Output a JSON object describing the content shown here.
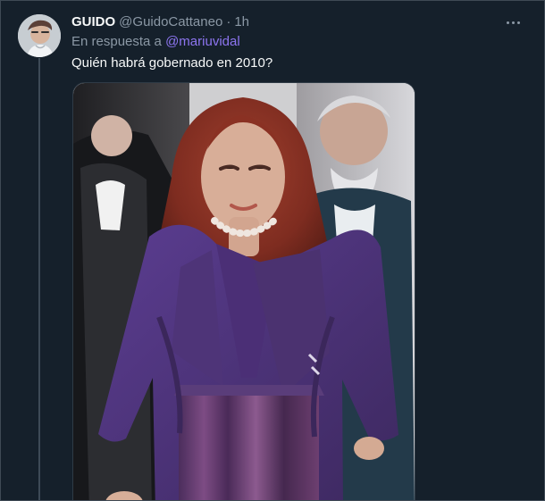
{
  "tweet": {
    "display_name": "GUIDO",
    "handle": "@GuidoCattaneo",
    "separator": "·",
    "time": "1h",
    "reply_prefix": "En respuesta a",
    "reply_to": "@mariuvidal",
    "text": "Quién habrá gobernado en 2010?"
  },
  "icons": {
    "avatar": "avatar-photo",
    "more": "more-options-icon",
    "media": "tweet-photo"
  },
  "colors": {
    "background": "#15202b",
    "primary_text": "#f7f9f9",
    "secondary_text": "#8b98a5",
    "link": "#8d75f0"
  }
}
